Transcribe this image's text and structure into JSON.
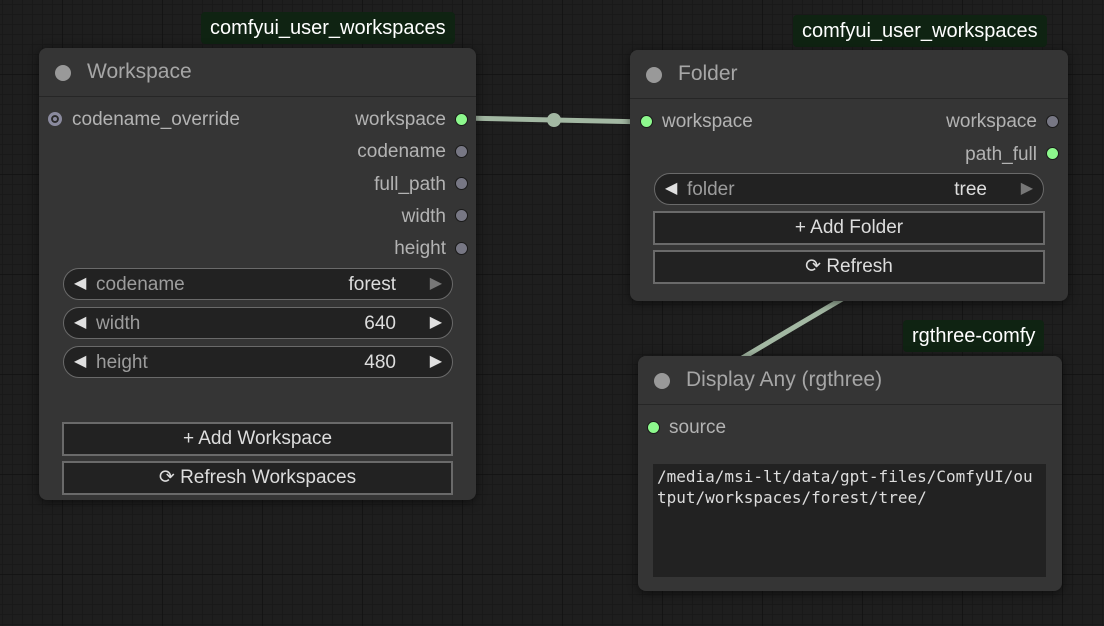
{
  "colors": {
    "canvas_background": "#1e1e1e",
    "node_background": "#353535",
    "badge_background": "#0f2312",
    "link_color": "#a3b8a3",
    "slot_connected": "#8df88d",
    "slot_disconnected": "#777784"
  },
  "nodes": {
    "workspace": {
      "badge": "comfyui_user_workspaces",
      "title": "Workspace",
      "inputs": [
        {
          "label": "codename_override"
        }
      ],
      "outputs": [
        {
          "label": "workspace"
        },
        {
          "label": "codename"
        },
        {
          "label": "full_path"
        },
        {
          "label": "width"
        },
        {
          "label": "height"
        }
      ],
      "widgets": [
        {
          "label": "codename",
          "value": "forest"
        },
        {
          "label": "width",
          "value": "640"
        },
        {
          "label": "height",
          "value": "480"
        }
      ],
      "buttons": {
        "add": "+ Add Workspace",
        "refresh": "⟳ Refresh Workspaces"
      }
    },
    "folder": {
      "badge": "comfyui_user_workspaces",
      "title": "Folder",
      "inputs": [
        {
          "label": "workspace"
        }
      ],
      "outputs": [
        {
          "label": "workspace"
        },
        {
          "label": "path_full"
        }
      ],
      "widgets": [
        {
          "label": "folder",
          "value": "tree"
        }
      ],
      "buttons": {
        "add": "+ Add Folder",
        "refresh": "⟳ Refresh"
      }
    },
    "display_any": {
      "badge": "rgthree-comfy",
      "title": "Display Any (rgthree)",
      "inputs": [
        {
          "label": "source"
        }
      ],
      "output_text": "/media/msi-lt/data/gpt-files/ComfyUI/output/workspaces/forest/tree/"
    }
  },
  "icons": {
    "arrow_left": "◀",
    "arrow_right": "▶"
  }
}
